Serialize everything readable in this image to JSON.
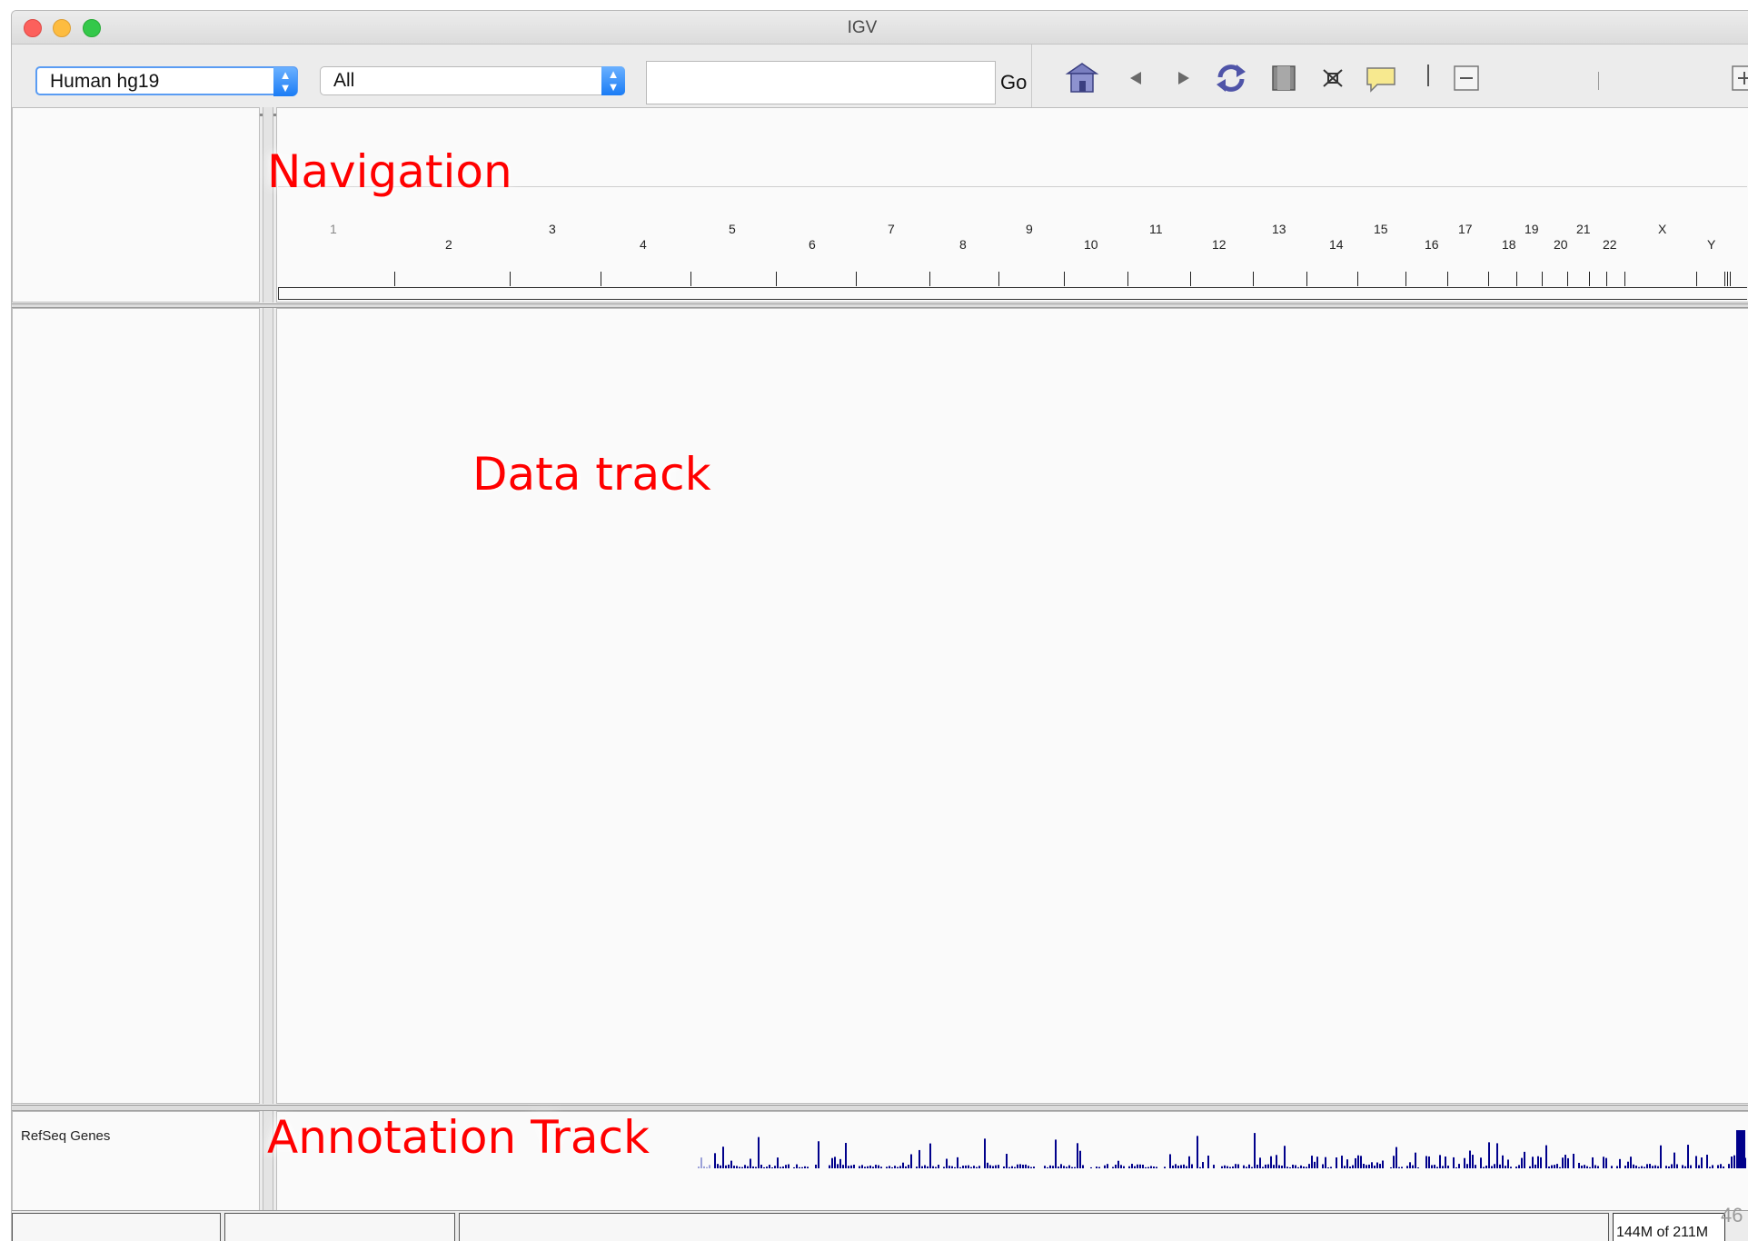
{
  "window": {
    "title": "IGV"
  },
  "toolbar": {
    "genome": "Human hg19",
    "chromosome": "All",
    "locus_value": "",
    "go_label": "Go"
  },
  "ruler": {
    "chromosomes_top": [
      "1",
      "3",
      "5",
      "7",
      "9",
      "11",
      "13",
      "15",
      "17",
      "19",
      "21",
      "X"
    ],
    "chromosomes_bottom": [
      "2",
      "4",
      "6",
      "8",
      "10",
      "12",
      "14",
      "16",
      "18",
      "20",
      "22",
      "Y"
    ]
  },
  "annotations": {
    "navigation": "Navigation",
    "data_track": "Data track",
    "annotation_track": "Annotation Track"
  },
  "tracks": {
    "refseq_name": "RefSeq Genes"
  },
  "status": {
    "memory": "144M of 211M",
    "page_number": "46"
  },
  "colors": {
    "annotation_text": "#ff0000",
    "gene_density": "#00008b",
    "genome_select_border": "#5a9cf3"
  }
}
